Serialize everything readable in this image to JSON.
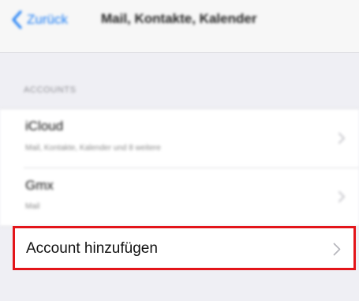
{
  "nav": {
    "back_label": "Zurück",
    "title": "Mail, Kontakte, Kalender"
  },
  "section_header": "ACCOUNTS",
  "accounts": [
    {
      "name": "iCloud",
      "detail": "Mail, Kontakte, Kalender und 8 weitere"
    },
    {
      "name": "Gmx",
      "detail": "Mail"
    }
  ],
  "add_account_label": "Account hinzufügen",
  "colors": {
    "accent": "#1a7cf5",
    "highlight_border": "#e3151a",
    "background": "#efeff4"
  },
  "icons": {
    "back": "chevron-left-icon",
    "disclosure": "chevron-right-icon"
  }
}
